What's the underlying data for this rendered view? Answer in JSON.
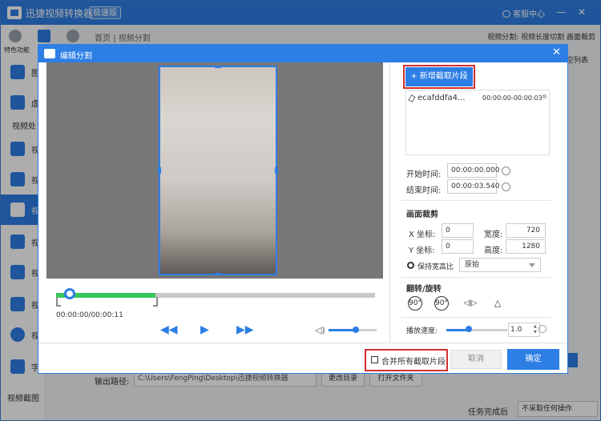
{
  "app": {
    "title": "迅捷视频转换器",
    "badge": "极速版",
    "service": "客服中心",
    "minimize": "—",
    "close": "✕"
  },
  "sidebar": {
    "top_label": "特色功能",
    "section_label": "视频处",
    "items": [
      {
        "label": "图"
      },
      {
        "label": "虚"
      },
      {
        "label": "视"
      },
      {
        "label": "视"
      },
      {
        "label": "视"
      },
      {
        "label": "视"
      },
      {
        "label": "视"
      },
      {
        "label": "视"
      },
      {
        "label": "视"
      },
      {
        "label": "字"
      }
    ],
    "bottom_label": "视频截图"
  },
  "breadcrumb": {
    "home": "首页",
    "separator": "|",
    "current": "视频分割"
  },
  "background": {
    "crumb_right": "视频分割: 视频长度切割 画面裁剪",
    "list_button": "空列表",
    "output_label": "输出路径:",
    "output_path": "C:\\Users\\FengPing\\Desktop\\迅捷视频转换器",
    "change_dir": "更改目录",
    "open_folder": "打开文件夹",
    "task_label": "任务完成后",
    "task_value": "不采取任何操作"
  },
  "dialog": {
    "title": "编辑分割",
    "close": "✕",
    "add_clip": "+ 新增截取片段",
    "clip": {
      "name": "ecafddfa4...",
      "range": "00:00:00-00:00:03",
      "remove": "⊗"
    },
    "start_label": "开始时间:",
    "start_value": "00:00:00.000",
    "end_label": "结束时间:",
    "end_value": "00:00:03.540",
    "crop_title": "画面裁剪",
    "x_label": "X 坐标:",
    "x_value": "0",
    "y_label": "Y 坐标:",
    "y_value": "0",
    "width_label": "宽度:",
    "width_value": "720",
    "height_label": "高度:",
    "height_value": "1280",
    "keep_ratio": "保持宽高比",
    "ratio_value": "原始",
    "rotate_title": "翻转/旋转",
    "rotate_left": "90°",
    "rotate_right": "90°",
    "flip_h": "◁|▷",
    "flip_v": "△",
    "speed_label": "播放速度:",
    "speed_value": "1.0",
    "time_display": "00:00:00/00:00:11",
    "rewind": "◀◀",
    "play": "▶",
    "forward": "▶▶",
    "volume": "◁)",
    "merge_label": "合并所有截取片段",
    "cancel": "取消",
    "ok": "确定"
  }
}
